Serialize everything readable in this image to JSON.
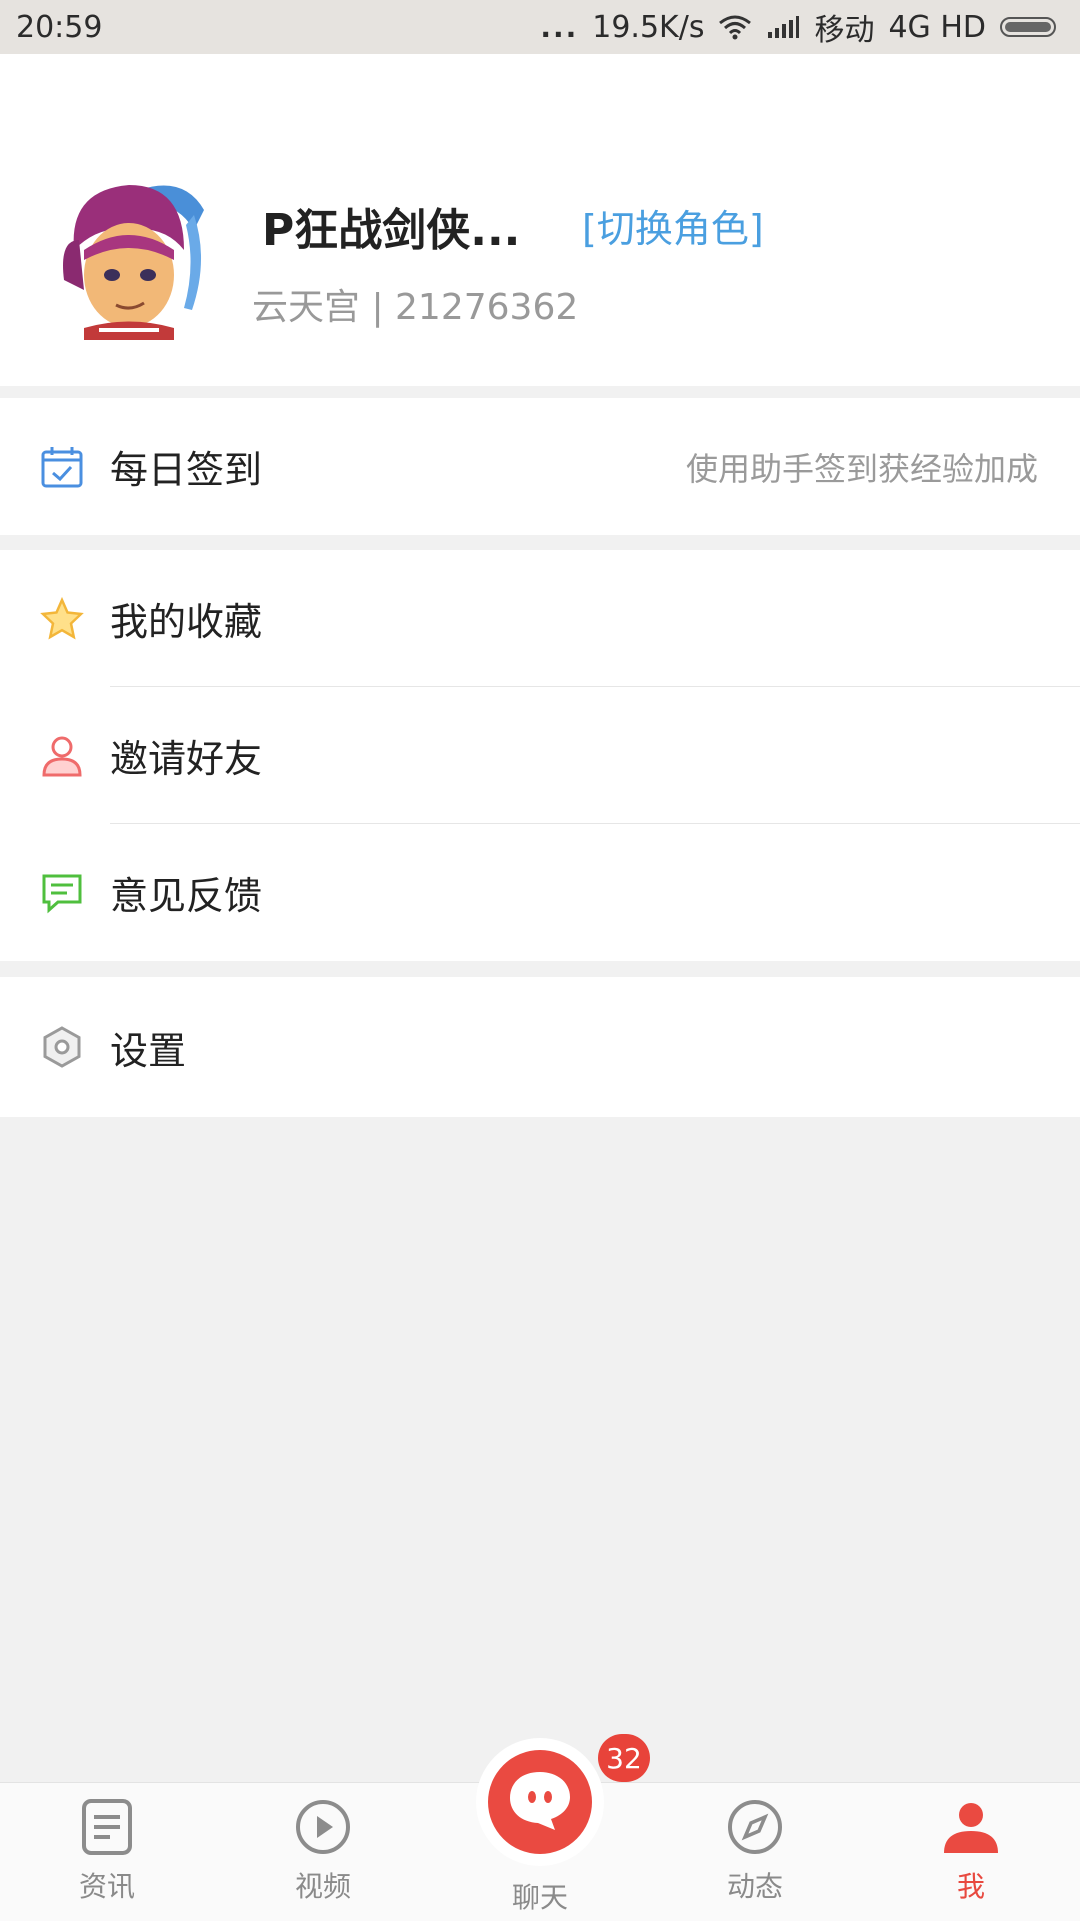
{
  "status_bar": {
    "time": "20:59",
    "dots": "...",
    "net_speed": "19.5K/s",
    "carrier": "移动",
    "network": "4G HD"
  },
  "profile": {
    "nickname": "P狂战剑侠...",
    "switch_role": "[切换角色]",
    "server_line": "云天宫 | 21276362"
  },
  "menu": {
    "checkin": {
      "label": "每日签到",
      "hint": "使用助手签到获经验加成",
      "icon": "calendar-check-icon"
    },
    "favorites": {
      "label": "我的收藏",
      "icon": "star-icon"
    },
    "invite": {
      "label": "邀请好友",
      "icon": "user-icon"
    },
    "feedback": {
      "label": "意见反馈",
      "icon": "chat-bubble-icon"
    },
    "settings": {
      "label": "设置",
      "icon": "hexagon-gear-icon"
    }
  },
  "bottom_nav": {
    "news": "资讯",
    "video": "视频",
    "chat": "聊天",
    "chat_badge": "32",
    "moments": "动态",
    "me": "我"
  },
  "colors": {
    "accent": "#e8493f",
    "link": "#4a9fe0",
    "background": "#f1f1f1"
  }
}
